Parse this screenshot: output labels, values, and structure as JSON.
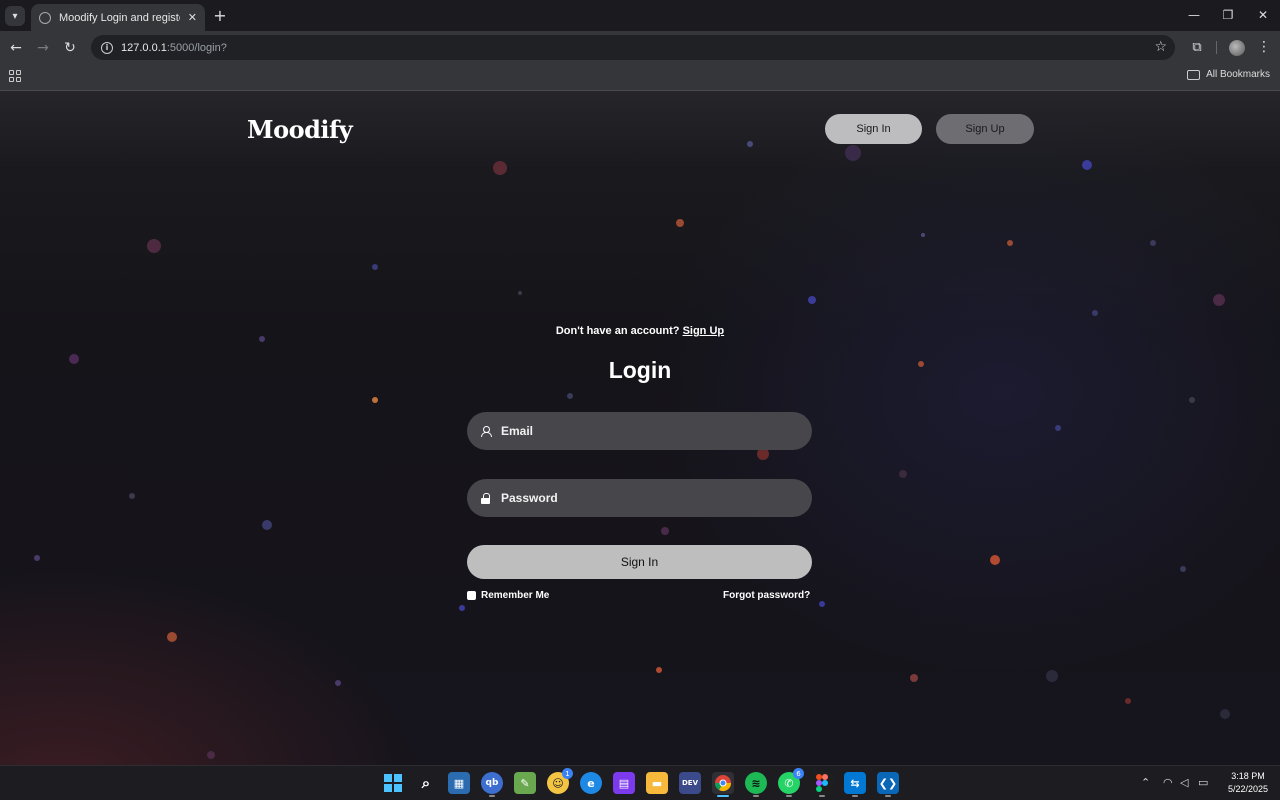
{
  "browser": {
    "tab_title": "Moodify Login and register page",
    "url_host": "127.0.0.1",
    "url_path": ":5000/login?",
    "bookmarks_label": "All Bookmarks",
    "icons": [
      "tab-search-icon",
      "close-icon",
      "plus-icon",
      "minimize-icon",
      "restore-icon",
      "back-icon",
      "forward-icon",
      "reload-icon",
      "info-icon",
      "star-icon",
      "extensions-icon",
      "profile-icon",
      "kebab-menu-icon",
      "apps-icon",
      "folder-icon"
    ]
  },
  "header": {
    "logo": "Moodify",
    "signin_label": "Sign In",
    "signup_label": "Sign Up"
  },
  "login": {
    "prompt": "Don't have an account?",
    "signup_link": "Sign Up",
    "title": "Login",
    "email_placeholder": "Email",
    "password_placeholder": "Password",
    "submit_label": "Sign In",
    "remember_label": "Remember Me",
    "forgot_label": "Forgot password?"
  },
  "colors": {
    "background": "#151419",
    "field": "#47464b",
    "primary_button": "#bebebf",
    "secondary_button": "#6e6d72"
  },
  "taskbar": {
    "apps": [
      "windows-start",
      "search",
      "microsoft-store",
      "qbittorrent",
      "notepad-plus-plus",
      "app-with-badge",
      "edge",
      "winrar",
      "file-explorer",
      "dev-home",
      "chrome",
      "spotify",
      "whatsapp",
      "figma",
      "remote-desktop",
      "vs-code"
    ],
    "badges": {
      "app-with-badge": "1",
      "whatsapp": "6"
    },
    "time": "3:18 PM",
    "date": "5/22/2025"
  }
}
